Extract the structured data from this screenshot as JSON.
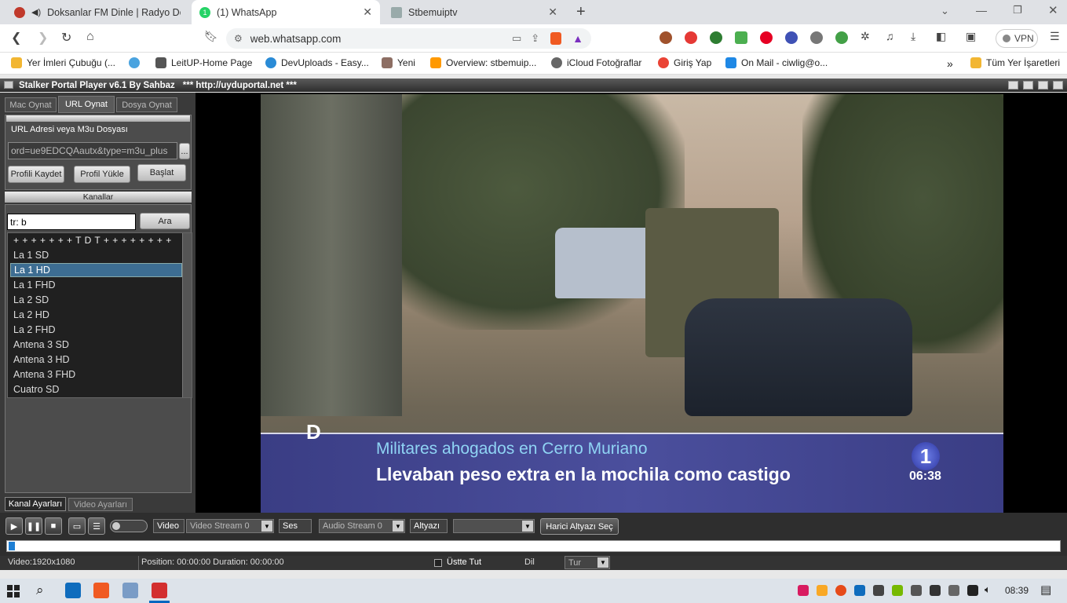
{
  "browser": {
    "tabs": [
      {
        "title": "Doksanlar FM Dinle | Radyo Doksa",
        "favicon_color": "#c0392b"
      },
      {
        "title": "(1) WhatsApp",
        "favicon_color": "#25d366"
      },
      {
        "title": "Stbemuiptv",
        "favicon_color": "#888888"
      }
    ],
    "new_tab": "+",
    "url": "web.whatsapp.com",
    "vpn_label": "VPN",
    "bookmarks": [
      "Yer İmleri Çubuğu (...",
      "LeitUP-Home Page",
      "DevUploads - Easy...",
      "Yeni",
      "Overview: stbemuip...",
      "iCloud Fotoğraflar",
      "Giriş Yap",
      "On Mail - ciwlig@o..."
    ],
    "bookmarks_more": "»",
    "all_bookmarks": "Tüm Yer İşaretleri"
  },
  "app": {
    "title": "Stalker Portal Player v6.1 By Sahbaz",
    "title_url": "*** http://uyduportal.net ***",
    "tabs": [
      "Mac Oynat",
      "URL Oynat",
      "Dosya Oynat"
    ],
    "url_section_label": "URL Adresi veya M3u Dosyası",
    "url_value": "ord=ue9EDCQAautx&type=m3u_plus",
    "browse_button": "...",
    "buttons": {
      "save": "Profili Kaydet",
      "load": "Profil Yükle",
      "start": "Başlat"
    },
    "channels_header": "Kanallar",
    "search_value": "tr: b",
    "search_button": "Ara",
    "channel_group": "+ + + + + + + T D T + + + + + + + +",
    "channels": [
      "La 1 SD",
      "La 1 HD",
      "La 1 FHD",
      "La 2 SD",
      "La 2 HD",
      "La 2 FHD",
      "Antena 3 SD",
      "Antena 3 HD",
      "Antena 3 FHD",
      "Cuatro SD"
    ],
    "selected_channel": "La 1 HD",
    "bottom_tabs": [
      "Kanal Ayarları",
      "Video Ayarları"
    ],
    "video": {
      "headline": "Militares ahogados en Cerro Muriano",
      "subline": "Llevaban peso extra en la mochila como castigo",
      "channel_number": "1",
      "clock": "06:38",
      "logo_letter": "D"
    },
    "controls": {
      "video_label": "Video",
      "video_stream": "Video Stream 0",
      "audio_label": "Ses",
      "audio_stream": "Audio Stream 0",
      "sub_label": "Altyazı",
      "sub_value": "",
      "external_sub": "Harici Altyazı Seç",
      "progress": 0.005
    },
    "status": {
      "resolution": "Video:1920x1080",
      "position": "Position: 00:00:00 Duration: 00:00:00",
      "on_top": "Üstte Tut",
      "lang_label": "Dil",
      "lang_value": "Tur"
    }
  },
  "taskbar": {
    "clock": "08:39"
  }
}
